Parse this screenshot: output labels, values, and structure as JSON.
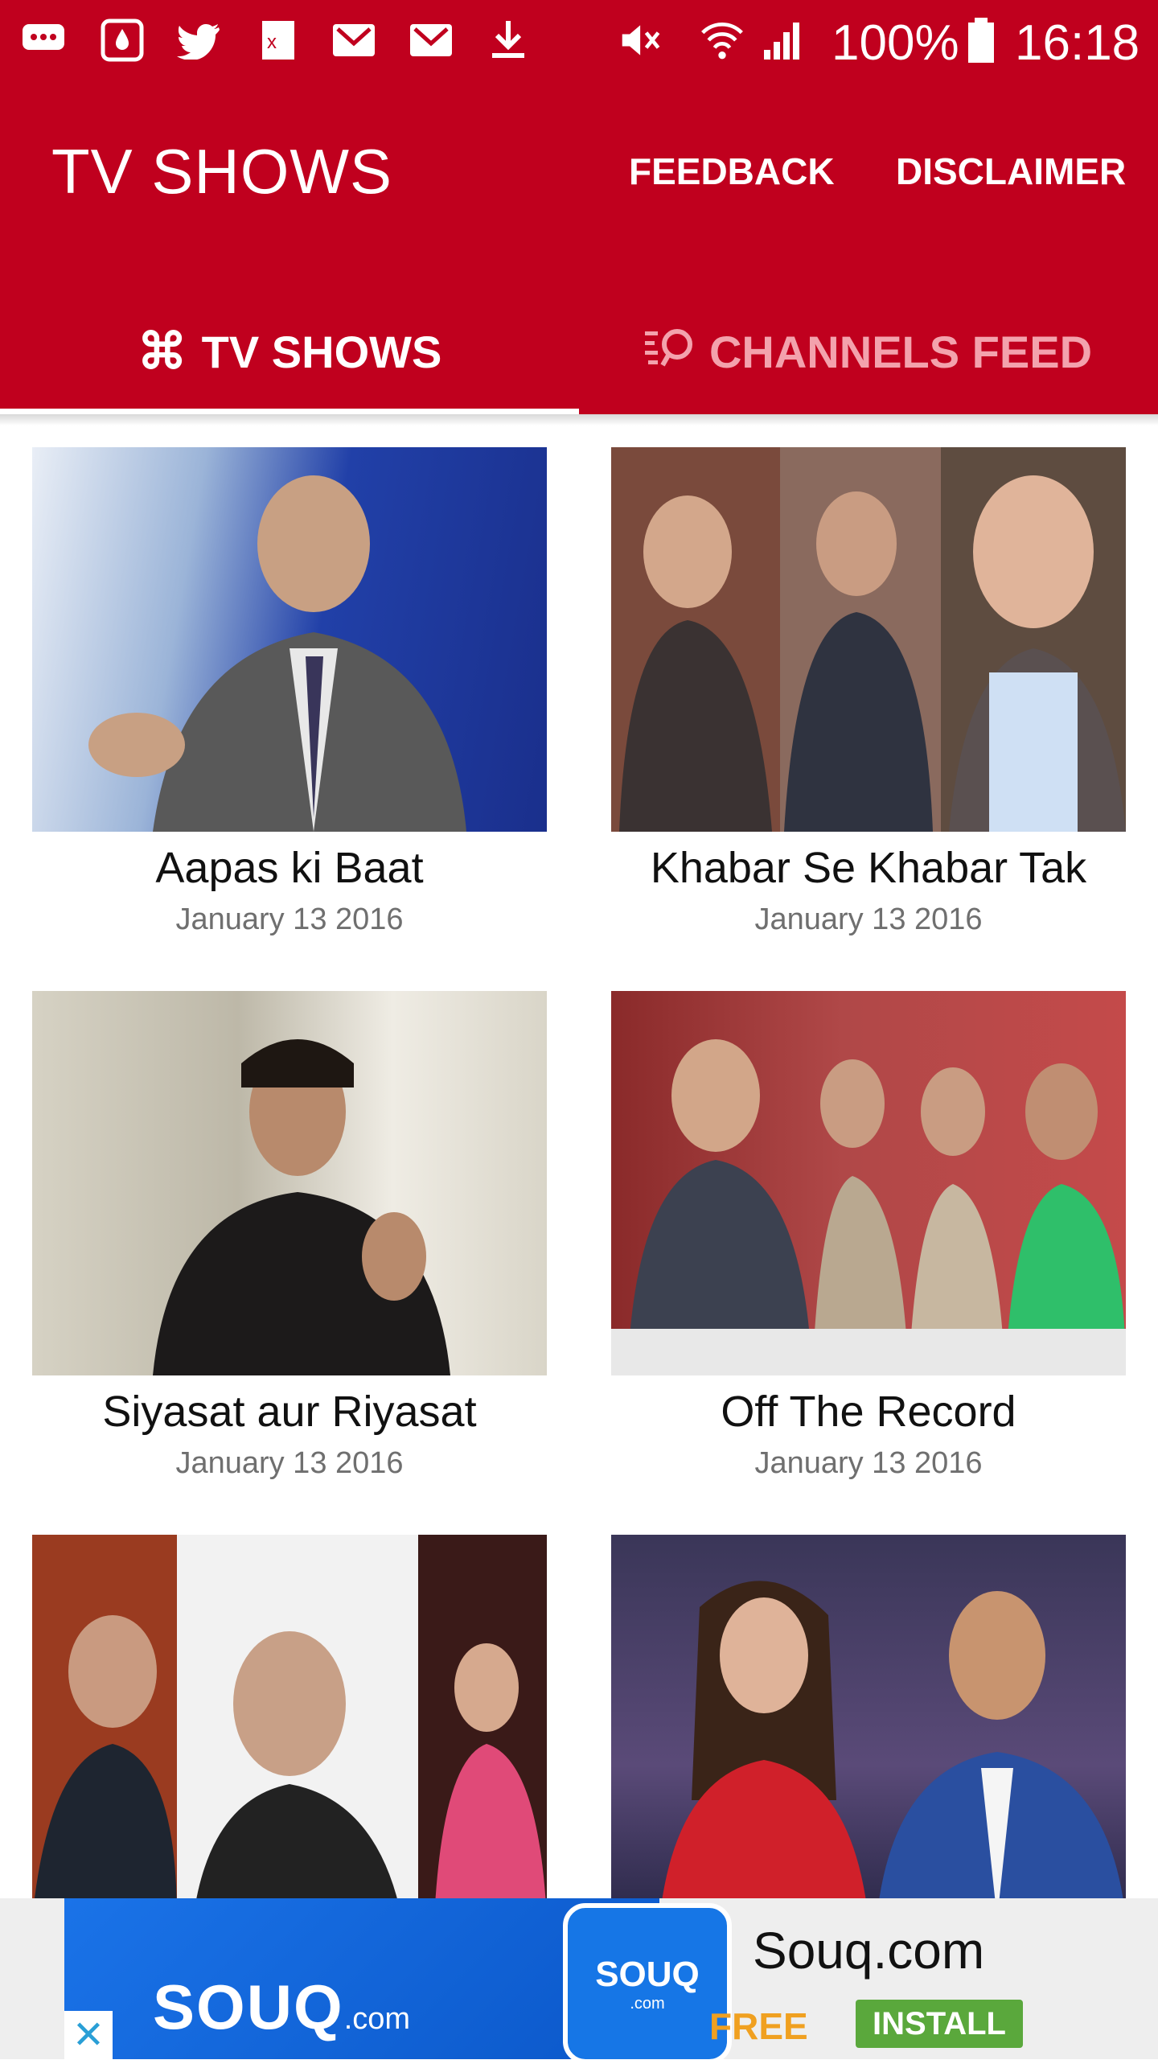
{
  "status_bar": {
    "battery": "100%",
    "time": "16:18",
    "icons": [
      "message-icon",
      "dropbox-icon",
      "twitter-icon",
      "excel-icon",
      "gmail-icon",
      "gmail-icon",
      "download-icon",
      "mute-icon",
      "wifi-icon",
      "signal-icon",
      "battery-icon"
    ]
  },
  "appbar": {
    "title": "TV SHOWS",
    "actions": [
      "FEEDBACK",
      "DISCLAIMER"
    ],
    "color": "#c0001e"
  },
  "tabs": [
    {
      "label": "TV SHOWS",
      "icon": "command-icon",
      "active": true
    },
    {
      "label": "CHANNELS FEED",
      "icon": "feed-icon",
      "active": false
    }
  ],
  "shows": [
    {
      "title": "Aapas ki Baat",
      "date": "January 13 2016"
    },
    {
      "title": "Khabar Se Khabar Tak",
      "date": "January 13 2016"
    },
    {
      "title": "Siyasat aur Riyasat",
      "date": "January 13 2016"
    },
    {
      "title": "Off The Record",
      "date": "January 13 2016"
    },
    {
      "title": "",
      "date": ""
    },
    {
      "title": "",
      "date": ""
    }
  ],
  "ad": {
    "wordmark": "SOUQ",
    "wordmark_suffix": ".com",
    "app_icon_text": "SOUQ",
    "app_icon_suffix": ".com",
    "name": "Souq.com",
    "free_label": "FREE",
    "install_label": "INSTALL"
  }
}
